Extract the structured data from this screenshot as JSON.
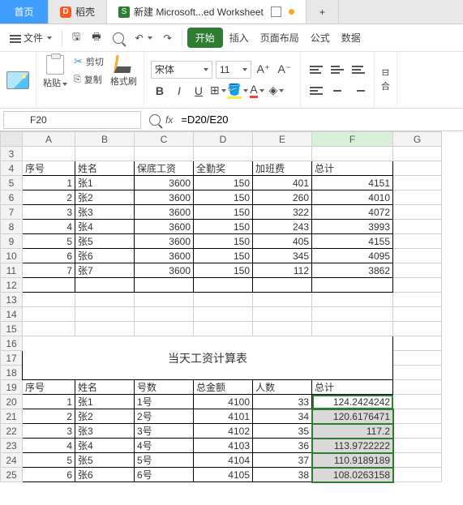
{
  "tabs": {
    "home": "首页",
    "wps": "稻壳",
    "wps_badge": "D",
    "doc": "新建 Microsoft...ed Worksheet",
    "sheet_badge": "S"
  },
  "menu": {
    "file": "文件",
    "start": "开始",
    "insert": "插入",
    "page_layout": "页面布局",
    "formulas": "公式",
    "data": "数据"
  },
  "toolbar": {
    "paste": "粘贴",
    "cut": "剪切",
    "copy": "复制",
    "format_painter": "格式刷",
    "font_name": "宋体",
    "font_size": "11",
    "bold": "B",
    "italic": "I",
    "underline": "U",
    "fill_A": "A",
    "font_A": "A",
    "merge": "合"
  },
  "formula_bar": {
    "name_box": "F20",
    "fx": "fx",
    "formula": "=D20/E20"
  },
  "grid": {
    "col_headers": [
      "A",
      "B",
      "C",
      "D",
      "E",
      "F",
      "G"
    ],
    "row_start": 3,
    "row_end": 25,
    "header1": {
      "a": "序号",
      "b": "姓名",
      "c": "保底工资",
      "d": "全勤奖",
      "e": "加班费",
      "f": "总计"
    },
    "table1": [
      {
        "a": "1",
        "b": "张1",
        "c": "3600",
        "d": "150",
        "e": "401",
        "f": "4151"
      },
      {
        "a": "2",
        "b": "张2",
        "c": "3600",
        "d": "150",
        "e": "260",
        "f": "4010"
      },
      {
        "a": "3",
        "b": "张3",
        "c": "3600",
        "d": "150",
        "e": "322",
        "f": "4072"
      },
      {
        "a": "4",
        "b": "张4",
        "c": "3600",
        "d": "150",
        "e": "243",
        "f": "3993"
      },
      {
        "a": "5",
        "b": "张5",
        "c": "3600",
        "d": "150",
        "e": "405",
        "f": "4155"
      },
      {
        "a": "6",
        "b": "张6",
        "c": "3600",
        "d": "150",
        "e": "345",
        "f": "4095"
      },
      {
        "a": "7",
        "b": "张7",
        "c": "3600",
        "d": "150",
        "e": "112",
        "f": "3862"
      }
    ],
    "title2": "当天工资计算表",
    "header2": {
      "a": "序号",
      "b": "姓名",
      "c": "号数",
      "d": "总金额",
      "e": "人数",
      "f": "总计"
    },
    "table2": [
      {
        "a": "1",
        "b": "张1",
        "c": "1号",
        "d": "4100",
        "e": "33",
        "f": "124.2424242"
      },
      {
        "a": "2",
        "b": "张2",
        "c": "2号",
        "d": "4101",
        "e": "34",
        "f": "120.6176471"
      },
      {
        "a": "3",
        "b": "张3",
        "c": "3号",
        "d": "4102",
        "e": "35",
        "f": "117.2"
      },
      {
        "a": "4",
        "b": "张4",
        "c": "4号",
        "d": "4103",
        "e": "36",
        "f": "113.9722222"
      },
      {
        "a": "5",
        "b": "张5",
        "c": "5号",
        "d": "4104",
        "e": "37",
        "f": "110.9189189"
      },
      {
        "a": "6",
        "b": "张6",
        "c": "6号",
        "d": "4105",
        "e": "38",
        "f": "108.0263158"
      }
    ]
  }
}
